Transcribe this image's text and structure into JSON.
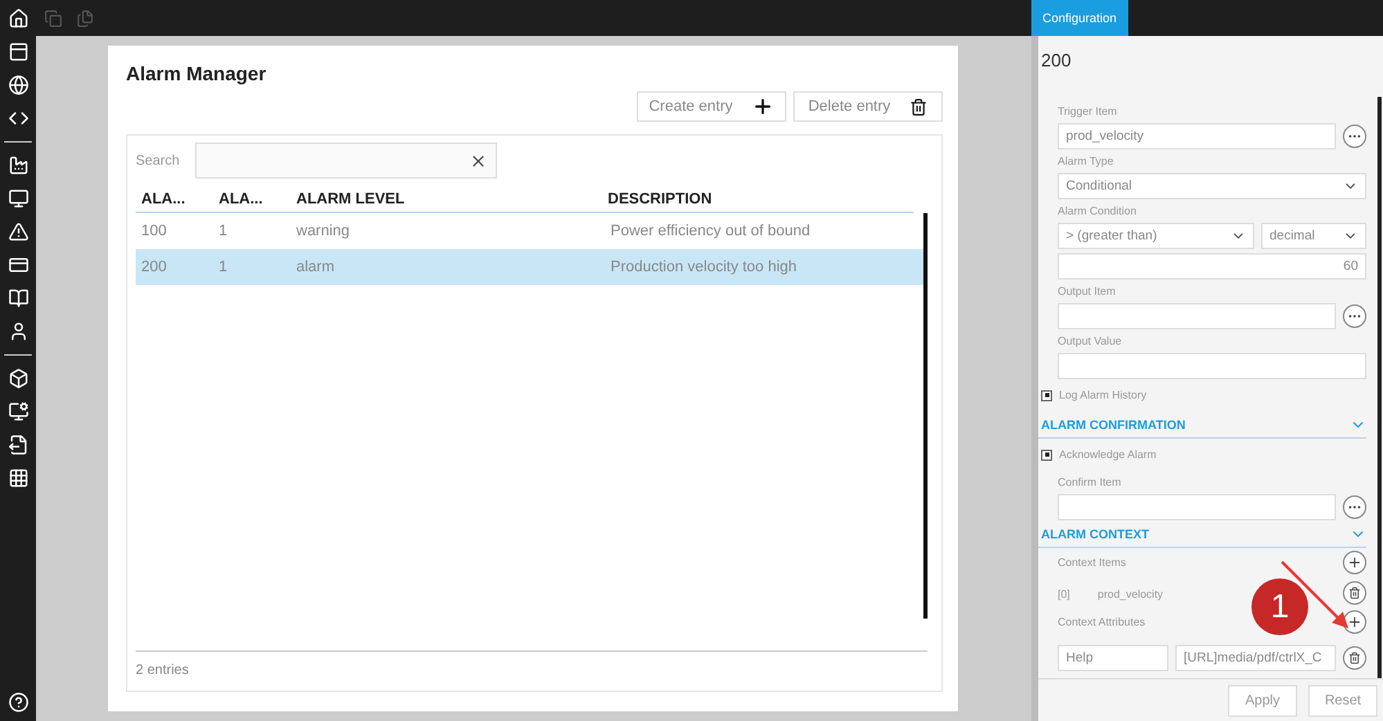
{
  "alarm_manager": {
    "title": "Alarm Manager",
    "buttons": [
      {
        "label": "Create entry",
        "kind": "create"
      },
      {
        "label": "Delete entry",
        "kind": "delete"
      }
    ],
    "search": {
      "label": "Search"
    },
    "table": {
      "columns": [
        "ALA...",
        "ALA...",
        "ALARM LEVEL",
        "DESCRIPTION"
      ],
      "rows": [
        {
          "cells": [
            "100",
            "1",
            "warning",
            "Power efficiency out of bound"
          ],
          "selected": false
        },
        {
          "cells": [
            "200",
            "1",
            "alarm",
            "Production velocity too high"
          ],
          "selected": true
        }
      ]
    },
    "footer": "2 entries"
  },
  "config_panel": {
    "tab": {
      "label": "Configuration",
      "selected": true
    },
    "title": "200",
    "items": [
      {
        "kind": "field",
        "label": "Trigger Item",
        "value": "prod_velocity",
        "browse": true
      },
      {
        "kind": "select",
        "label": "Alarm Type",
        "value": "Conditional"
      },
      {
        "kind": "condition",
        "label": "Alarm Condition",
        "operator": "> (greater than)",
        "type": "decimal",
        "value": "60"
      },
      {
        "kind": "field",
        "label": "Output Item",
        "browse": true
      },
      {
        "kind": "field",
        "label": "Output Value",
        "browse": false
      },
      {
        "kind": "checkbox",
        "label": "Log Alarm History",
        "checked": true
      },
      {
        "kind": "section",
        "label": "ALARM CONFIRMATION",
        "expanded": true
      },
      {
        "kind": "checkbox",
        "label": "Acknowledge Alarm",
        "checked": true
      },
      {
        "kind": "field",
        "label": "Confirm Item",
        "browse": true
      },
      {
        "kind": "section",
        "label": "ALARM CONTEXT",
        "expanded": true
      },
      {
        "kind": "list_header",
        "label": "Context Items"
      },
      {
        "kind": "list_entry",
        "index": "[0]",
        "value": "prod_velocity"
      },
      {
        "kind": "list_header",
        "label": "Context Attributes"
      },
      {
        "kind": "attribute",
        "key": "Help",
        "value": "[URL]media/pdf/ctrlX_C"
      }
    ],
    "buttons": [
      "Apply",
      "Reset"
    ]
  },
  "annotation": {
    "label": "1"
  }
}
